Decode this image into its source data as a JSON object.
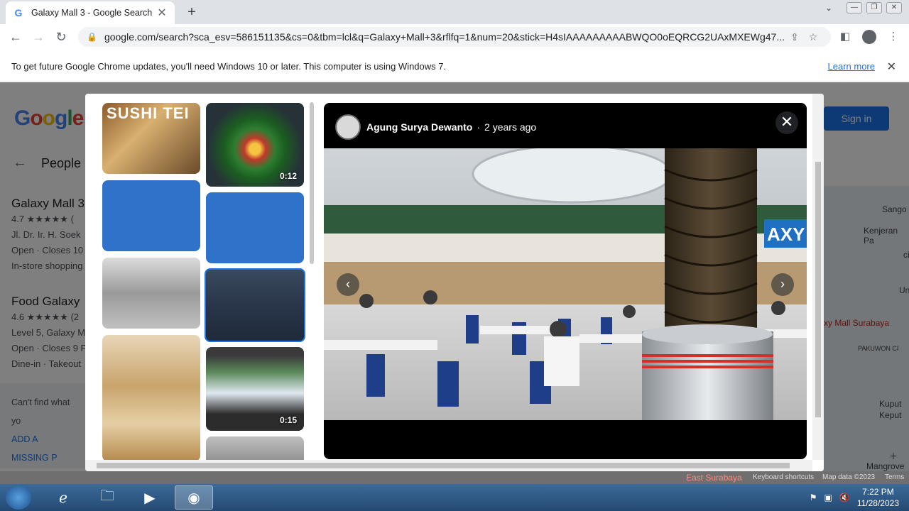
{
  "browser": {
    "tab_title": "Galaxy Mall 3 - Google Search",
    "tab_favicon": "G",
    "url": "google.com/search?sca_esv=586151135&cs=0&tbm=lcl&q=Galaxy+Mall+3&rflfq=1&num=20&stick=H4sIAAAAAAAAABWQO0oEQRCG2UAxMXEWg47...",
    "new_tab": "+",
    "tab_close": "✕"
  },
  "infobar": {
    "message": "To get future Google Chrome updates, you'll need Windows 10 or later. This computer is using Windows 7.",
    "link": "Learn more",
    "close": "✕"
  },
  "background_page": {
    "logo": "Google",
    "people_label": "People",
    "sign_in": "Sign in",
    "results": [
      {
        "title": "Galaxy Mall 3",
        "rating": "4.7 ★★★★★ (",
        "line1": "Jl. Dr. Ir. H. Soek",
        "line2": "Open · Closes 10",
        "line3": "In-store shopping"
      },
      {
        "title": "Food Galaxy",
        "rating": "4.6 ★★★★★ (2",
        "line1": "Level 5, Galaxy M",
        "line2": "Open · Closes 9 F",
        "line3": "Dine-in · Takeout"
      }
    ],
    "cant_find": "Can't find what yo",
    "add_missing": "ADD A MISSING P",
    "map_labels": [
      "Sango",
      "Kenjeran Pa",
      "ci",
      "Uni",
      "xy Mall Surabaya",
      "PAKUWON CI",
      "Kuput",
      "Keput",
      "Mangrove W",
      "East Surabaya"
    ],
    "map_footer": [
      "Keyboard shortcuts",
      "Map data ©2023",
      "Terms"
    ]
  },
  "modal": {
    "author": "Agung Surya Dewanto",
    "separator": "·",
    "time": "2 years ago",
    "close": "✕",
    "prev": "‹",
    "next": "›",
    "thumbnails": [
      {
        "label": "SUSHI TEI"
      },
      {
        "duration": "0:12"
      },
      {},
      {},
      {},
      {},
      {},
      {
        "duration": "0:15"
      },
      {}
    ],
    "photo_sign": "AXY"
  },
  "taskbar": {
    "time": "7:22 PM",
    "date": "11/28/2023"
  }
}
